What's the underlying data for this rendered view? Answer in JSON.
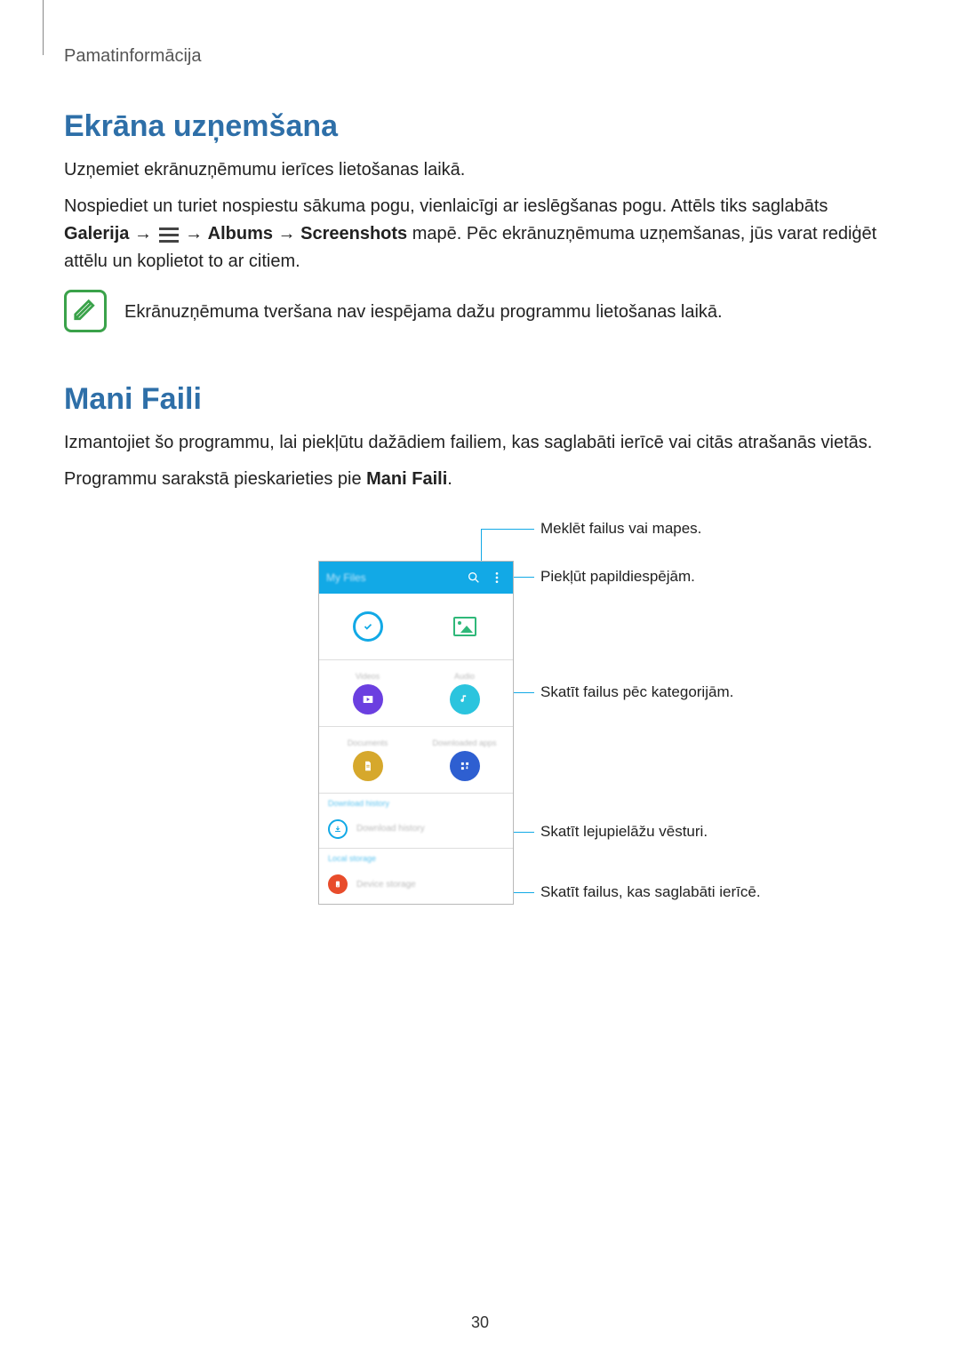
{
  "breadcrumb": "Pamatinformācija",
  "section1": {
    "heading": "Ekrāna uzņemšana",
    "p1": "Uzņemiet ekrānuzņēmumu ierīces lietošanas laikā.",
    "p2_a": "Nospiediet un turiet nospiestu sākuma pogu, vienlaicīgi ar ieslēgšanas pogu. Attēls tiks saglabāts ",
    "p2_bold1": "Galerija",
    "p2_arrow1": " → ",
    "p2_arrow2": " → ",
    "p2_bold2": "Albums",
    "p2_arrow3": " → ",
    "p2_bold3": "Screenshots",
    "p2_b": " mapē. Pēc ekrānuzņēmuma uzņemšanas, jūs varat rediģēt attēlu un koplietot to ar citiem.",
    "note": "Ekrānuzņēmuma tveršana nav iespējama dažu programmu lietošanas laikā."
  },
  "section2": {
    "heading": "Mani Faili",
    "p1": "Izmantojiet šo programmu, lai piekļūtu dažādiem failiem, kas saglabāti ierīcē vai citās atrašanās vietās.",
    "p2_a": "Programmu sarakstā pieskarieties pie ",
    "p2_bold": "Mani Faili",
    "p2_b": "."
  },
  "phone": {
    "title": "My Files",
    "cat1": "Videos",
    "cat2": "Audio",
    "cat3": "Documents",
    "cat4": "Downloaded apps",
    "sec1": "Download history",
    "row1": "Download history",
    "sec2": "Local storage",
    "row2": "Device storage"
  },
  "callouts": {
    "search": "Meklēt failus vai mapes.",
    "more": "Piekļūt papildiespējām.",
    "categories": "Skatīt failus pēc kategorijām.",
    "downloads": "Skatīt lejupielāžu vēsturi.",
    "storage": "Skatīt failus, kas saglabāti ierīcē."
  },
  "page_number": "30"
}
